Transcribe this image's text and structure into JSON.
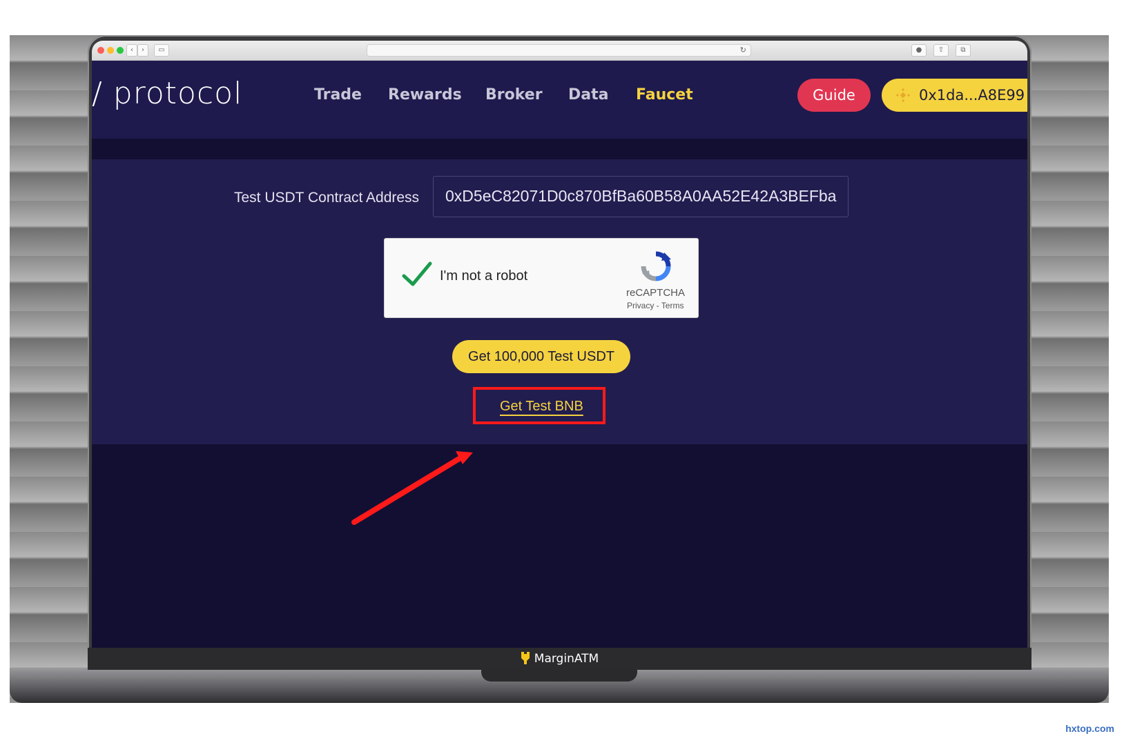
{
  "app": {
    "logo_text": "/ protocol",
    "nav": [
      {
        "label": "Trade"
      },
      {
        "label": "Rewards"
      },
      {
        "label": "Broker"
      },
      {
        "label": "Data"
      },
      {
        "label": "Faucet",
        "active": true
      }
    ],
    "guide_label": "Guide",
    "wallet_label": "0x1da...A8E99",
    "wallet_icon": "binance-diamond-icon"
  },
  "faucet": {
    "address_label": "Test USDT Contract Address",
    "address_value": "0xD5eC82071D0c870BfBa60B58A0AA52E42A3BEFba",
    "captcha": {
      "label": "I'm not a robot",
      "checked": true,
      "brand": "reCAPTCHA",
      "links": "Privacy - Terms"
    },
    "usdt_button_label": "Get 100,000 Test USDT",
    "bnb_link_label": "Get Test BNB"
  },
  "device": {
    "bezel_brand": "MarginATM"
  },
  "watermark": {
    "text": "hxtop.com"
  },
  "colors": {
    "accent_yellow": "#f5d33f",
    "guide_red": "#e13652",
    "highlight_red": "#ff1a1a",
    "panel_bg": "#221d4f",
    "header_bg": "#1e1a4d"
  }
}
